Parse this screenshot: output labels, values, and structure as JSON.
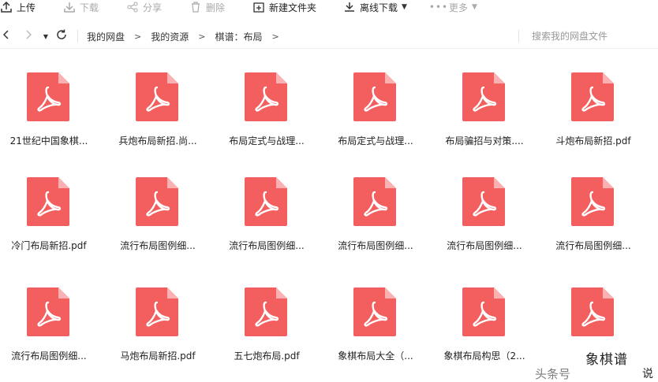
{
  "toolbar": {
    "upload": "上传",
    "download": "下载",
    "share": "分享",
    "delete": "删除",
    "new_folder": "新建文件夹",
    "offline_download": "离线下载",
    "more": "更多"
  },
  "nav": {
    "breadcrumbs": [
      "我的网盘",
      "我的资源",
      "棋谱：布局"
    ],
    "search_placeholder": "搜索我的网盘文件"
  },
  "files": [
    {
      "name": "21世纪中国象棋..."
    },
    {
      "name": "兵炮布局新招.尚..."
    },
    {
      "name": "布局定式与战理..."
    },
    {
      "name": "布局定式与战理..."
    },
    {
      "name": "布局骗招与对策...."
    },
    {
      "name": "斗炮布局新招.pdf"
    },
    {
      "name": "冷门布局新招.pdf"
    },
    {
      "name": "流行布局图例细..."
    },
    {
      "name": "流行布局图例细..."
    },
    {
      "name": "流行布局图例细..."
    },
    {
      "name": "流行布局图例细..."
    },
    {
      "name": "流行布局图例细..."
    },
    {
      "name": "流行布局图例细..."
    },
    {
      "name": "马炮布局新招.pdf"
    },
    {
      "name": "五七炮布局.pdf"
    },
    {
      "name": "象棋布局大全（..."
    },
    {
      "name": "象棋布局构思（2..."
    },
    {
      "name": ""
    }
  ],
  "watermark": {
    "line1": "头条号",
    "brand": "象棋谱",
    "line3": "说"
  },
  "colors": {
    "pdf_icon": "#f35e5e",
    "pdf_fold": "#fbb1b1"
  }
}
